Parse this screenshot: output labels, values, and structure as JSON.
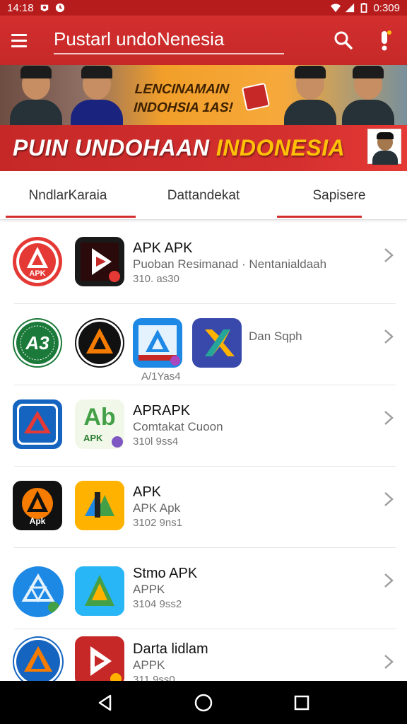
{
  "status_bar": {
    "time": "14:18",
    "battery_text": "0:309",
    "icons": [
      "notification-icon",
      "clock-icon",
      "wifi-icon",
      "signal-icon",
      "battery-icon"
    ]
  },
  "app_bar": {
    "title": "Pustarl undoNenesia",
    "icons": [
      "menu-icon",
      "search-icon",
      "alert-icon"
    ]
  },
  "banner": {
    "subtitle_line1": "LENCINAMAIN",
    "subtitle_line2": "INDOHSIA 1AS!",
    "title_main": "PUIN UNDOHAAN ",
    "title_accent": "INDONESIA"
  },
  "tabs": [
    {
      "label": "NndlarKaraia",
      "active": true
    },
    {
      "label": "Dattandekat",
      "active": false
    },
    {
      "label": "Sapisere",
      "active": true
    }
  ],
  "apps": [
    {
      "title": "APK APK",
      "subtitle": "Puoban Resimanad  ·  Nentanialdaah",
      "meta": "310. as30"
    },
    {
      "side_label": "Dan Sqph",
      "under_label": "A/1Yas4"
    },
    {
      "title": "APRAPK",
      "subtitle": "Comtakat Cuoon",
      "meta": "310l 9ss4"
    },
    {
      "title": "APK",
      "subtitle": "APK Apk",
      "meta": "3102 9ns1"
    },
    {
      "title": "Stmo APK",
      "subtitle": "APPK",
      "meta": "3104 9ss2"
    },
    {
      "title": "Darta lidlam",
      "subtitle": "APPK",
      "meta": "311 9ss0"
    }
  ],
  "icon_labels": {
    "apk_red": "APK",
    "apk_green": "APK",
    "apk_orange": "Apk",
    "as_green": "A3",
    "ab_green": "Ab"
  },
  "colors": {
    "primary": "#d32f2f",
    "primary_dark": "#b71c1c",
    "accent": "#ffc107"
  },
  "nav_bar": [
    "back-icon",
    "home-icon",
    "recents-icon"
  ]
}
